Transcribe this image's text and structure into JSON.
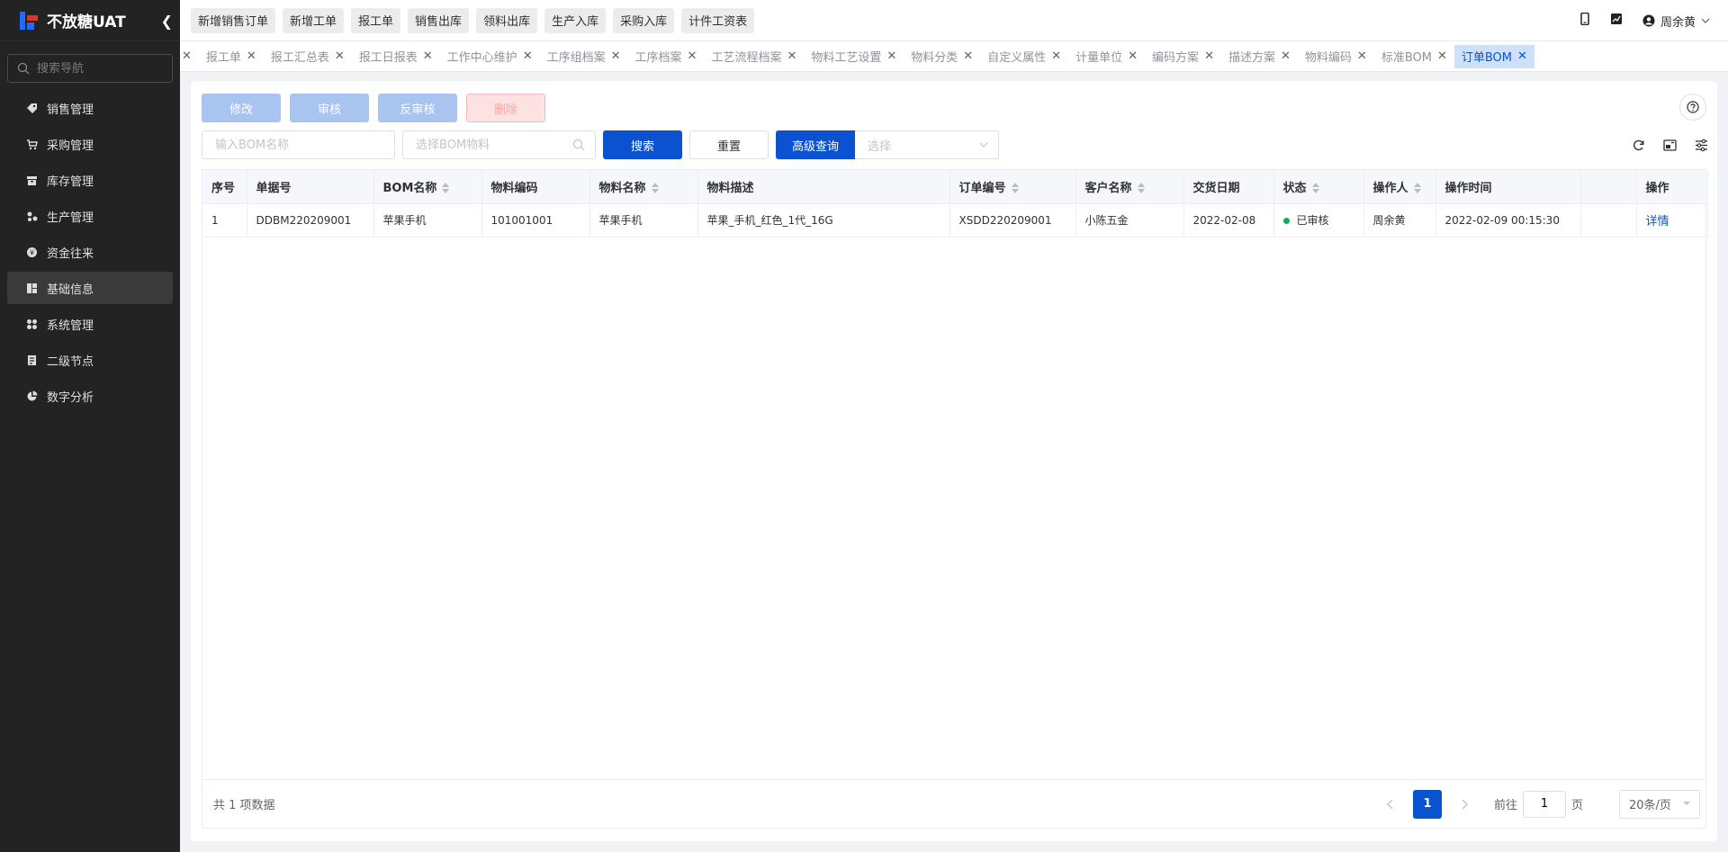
{
  "sidebar": {
    "brand": "不放糖UAT",
    "search_placeholder": "搜索导航",
    "items": [
      {
        "label": "销售管理",
        "icon": "tag-icon"
      },
      {
        "label": "采购管理",
        "icon": "cart-icon"
      },
      {
        "label": "库存管理",
        "icon": "inventory-icon"
      },
      {
        "label": "生产管理",
        "icon": "production-icon"
      },
      {
        "label": "资金往来",
        "icon": "money-icon"
      },
      {
        "label": "基础信息",
        "icon": "info-icon",
        "active": true
      },
      {
        "label": "系统管理",
        "icon": "grid-icon"
      },
      {
        "label": "二级节点",
        "icon": "document-icon"
      },
      {
        "label": "数字分析",
        "icon": "pie-chart-icon"
      }
    ]
  },
  "header": {
    "quick_actions": [
      "新增销售订单",
      "新增工单",
      "报工单",
      "销售出库",
      "领料出库",
      "生产入库",
      "采购入库",
      "计件工资表"
    ],
    "user_name": "周余黄"
  },
  "tabs": [
    "报工单",
    "报工汇总表",
    "报工日报表",
    "工作中心维护",
    "工序组档案",
    "工序档案",
    "工艺流程档案",
    "物料工艺设置",
    "物料分类",
    "自定义属性",
    "计量单位",
    "编码方案",
    "描述方案",
    "物料编码",
    "标准BOM",
    "订单BOM"
  ],
  "active_tab": "订单BOM",
  "toolbar": {
    "edit": "修改",
    "approve": "审核",
    "unapprove": "反审核",
    "delete": "删除"
  },
  "filters": {
    "bom_name_placeholder": "输入BOM名称",
    "bom_material_placeholder": "选择BOM物料",
    "search": "搜索",
    "reset": "重置",
    "advanced": "高级查询",
    "select_placeholder": "选择"
  },
  "table": {
    "columns": [
      "序号",
      "单据号",
      "BOM名称",
      "物料编码",
      "物料名称",
      "物料描述",
      "订单编号",
      "客户名称",
      "交货日期",
      "状态",
      "操作人",
      "操作时间",
      "",
      "操作"
    ],
    "rows": [
      {
        "index": "1",
        "doc_no": "DDBM220209001",
        "bom_name": "苹果手机",
        "material_code": "101001001",
        "material_name": "苹果手机",
        "material_desc": "苹果_手机_红色_1代_16G",
        "order_no": "XSDD220209001",
        "customer": "小陈五金",
        "delivery_date": "2022-02-08",
        "status": "已审核",
        "operator": "周余黄",
        "op_time": "2022-02-09 00:15:30",
        "action": "详情"
      }
    ]
  },
  "pagination": {
    "total_text": "共 1 项数据",
    "current_page": "1",
    "goto_label": "前往",
    "goto_value": "1",
    "page_unit": "页",
    "page_size": "20条/页"
  },
  "colors": {
    "primary": "#0b52d1",
    "sidebar_bg": "#232323",
    "status_ok": "#14a85d"
  }
}
